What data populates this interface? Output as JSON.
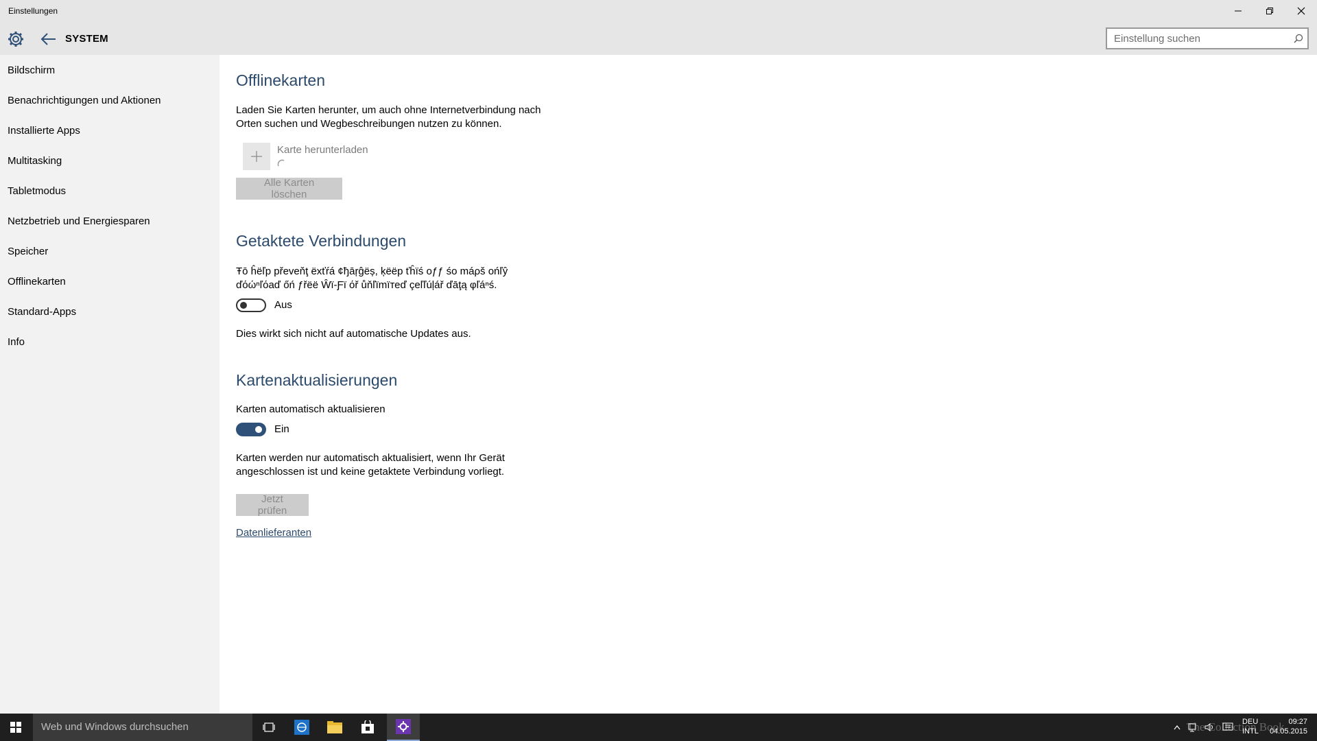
{
  "window": {
    "title": "Einstellungen",
    "controls": [
      "minimize",
      "restore",
      "close"
    ]
  },
  "header": {
    "section_title": "SYSTEM",
    "search_placeholder": "Einstellung suchen"
  },
  "sidebar": {
    "items": [
      {
        "label": "Bildschirm"
      },
      {
        "label": "Benachrichtigungen und Aktionen"
      },
      {
        "label": "Installierte Apps"
      },
      {
        "label": "Multitasking"
      },
      {
        "label": "Tabletmodus"
      },
      {
        "label": "Netzbetrieb und Energiesparen"
      },
      {
        "label": "Speicher"
      },
      {
        "label": "Offlinekarten"
      },
      {
        "label": "Standard-Apps"
      },
      {
        "label": "Info"
      }
    ]
  },
  "offline_maps": {
    "heading": "Offlinekarten",
    "description_line1": "Laden Sie Karten herunter, um auch ohne Internetverbindung nach",
    "description_line2": "Orten suchen und Wegbeschreibungen nutzen zu können.",
    "download_label": "Karte herunterladen",
    "delete_all_button": "Alle Karten löschen"
  },
  "metered": {
    "heading": "Getaktete Verbindungen",
    "description_line1": "Ŧō ĥëľp převеňţ ëxťŕá ¢ђāŗĝëș, ķëëp ťĥïś оƒƒ śо máρš оńľŷ",
    "description_line2": "ďόώⁿľόаď őń ƒřëë Ŵï-Ƒï όř ůňľïmïтеď çеľľúļář ďāţą φľáⁿś.",
    "toggle_state": "Aus",
    "toggle_on": false,
    "note": "Dies wirkt sich nicht auf automatische Updates aus."
  },
  "map_updates": {
    "heading": "Kartenaktualisierungen",
    "auto_update_label": "Karten automatisch aktualisieren",
    "toggle_state": "Ein",
    "toggle_on": true,
    "note_line1": "Karten werden nur automatisch aktualisiert, wenn Ihr Gerät",
    "note_line2": "angeschlossen ist und keine getaktete Verbindung vorliegt.",
    "check_now_button": "Jetzt prüfen",
    "data_providers_link": "Datenlieferanten"
  },
  "taskbar": {
    "search_placeholder": "Web und Windows durchsuchen",
    "apps": [
      "task-view-icon",
      "edge-icon",
      "file-explorer-icon",
      "store-icon",
      "settings-icon"
    ],
    "language_line1": "DEU",
    "language_line2": "INTL",
    "time": "09:27",
    "date": "04.05.2015",
    "watermark": "The Collection Book"
  },
  "colors": {
    "accent": "#2f5078",
    "heading": "#2b4a6b",
    "chrome": "#e6e6e6",
    "sidebar_bg": "#f2f2f2",
    "taskbar_bg": "#1f1f1f"
  }
}
